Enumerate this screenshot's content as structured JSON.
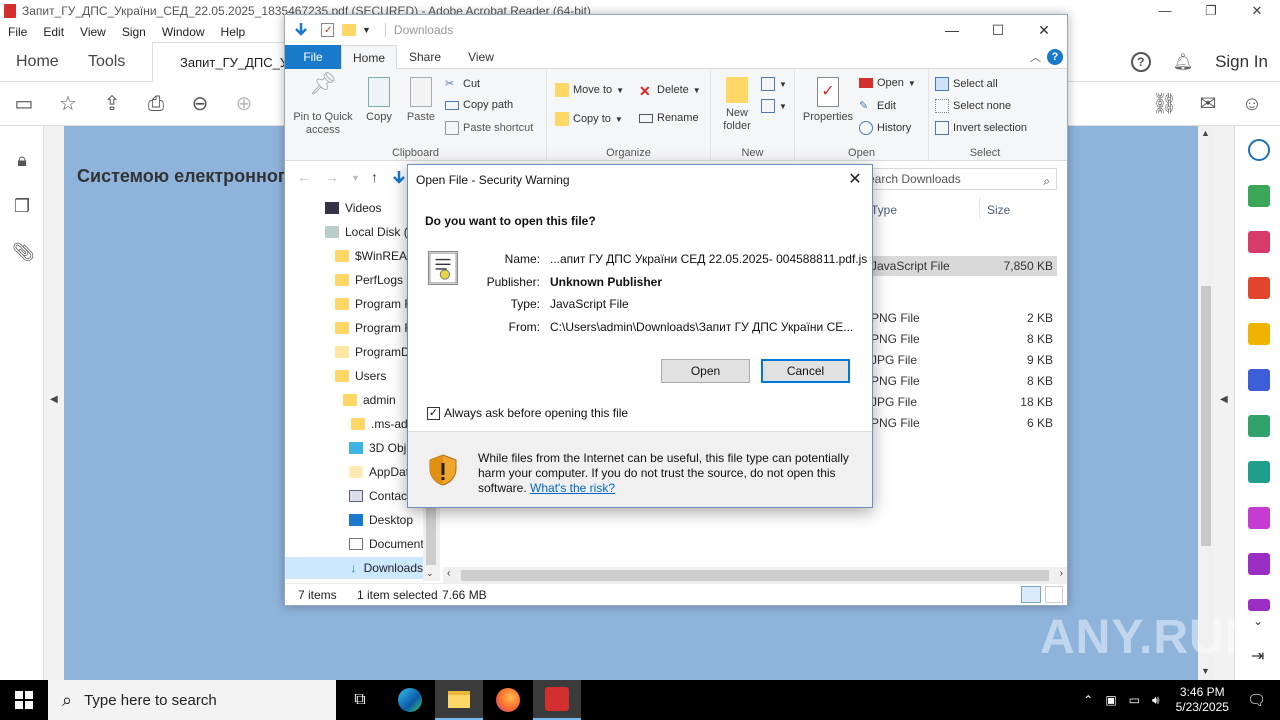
{
  "acrobat": {
    "title": "Запит_ГУ_ДПС_України_СЕД_22.05.2025_1835467235.pdf (SECURED) - Adobe Acrobat Reader (64-bit)",
    "menu": [
      "File",
      "Edit",
      "View",
      "Sign",
      "Window",
      "Help"
    ],
    "tabs": {
      "home": "Home",
      "tools": "Tools",
      "doc": "Запит_ГУ_ДПС_У"
    },
    "sign_in": "Sign In",
    "doc_heading": "Системою електронного"
  },
  "explorer": {
    "title": "Downloads",
    "ribbon_tabs": {
      "file": "File",
      "home": "Home",
      "share": "Share",
      "view": "View"
    },
    "clipboard": {
      "pin": "Pin to Quick access",
      "copy": "Copy",
      "paste": "Paste",
      "cut": "Cut",
      "copy_path": "Copy path",
      "paste_shortcut": "Paste shortcut",
      "label": "Clipboard"
    },
    "organize": {
      "move_to": "Move to",
      "copy_to": "Copy to",
      "delete": "Delete",
      "rename": "Rename",
      "label": "Organize"
    },
    "new": {
      "new_folder": "New folder",
      "label": "New"
    },
    "open": {
      "properties": "Properties",
      "open": "Open",
      "edit": "Edit",
      "history": "History",
      "label": "Open"
    },
    "select": {
      "select_all": "Select all",
      "select_none": "Select none",
      "invert": "Invert selection",
      "label": "Select"
    },
    "search_placeholder": "Search Downloads",
    "columns": {
      "type": "Type",
      "size": "Size"
    },
    "nav_items": [
      {
        "label": "Videos"
      },
      {
        "label": "Local Disk (C:)"
      },
      {
        "label": "$WinREAgent"
      },
      {
        "label": "PerfLogs"
      },
      {
        "label": "Program Files"
      },
      {
        "label": "Program Files (x86)"
      },
      {
        "label": "ProgramData"
      },
      {
        "label": "Users"
      },
      {
        "label": "admin"
      },
      {
        "label": ".ms-ad"
      },
      {
        "label": "3D Objects"
      },
      {
        "label": "AppData"
      },
      {
        "label": "Contacts"
      },
      {
        "label": "Desktop"
      },
      {
        "label": "Documents"
      },
      {
        "label": "Downloads"
      }
    ],
    "files": [
      {
        "type": "JavaScript File",
        "size": "7,850 KB",
        "selected": true
      },
      {
        "type": "PNG File",
        "size": "2 KB"
      },
      {
        "type": "PNG File",
        "size": "8 KB"
      },
      {
        "type": "JPG File",
        "size": "9 KB"
      },
      {
        "type": "PNG File",
        "size": "8 KB"
      },
      {
        "type": "JPG File",
        "size": "18 KB"
      },
      {
        "type": "PNG File",
        "size": "6 KB"
      }
    ],
    "status": {
      "count": "7 items",
      "selected": "1 item selected",
      "size": "7.66 MB"
    }
  },
  "dialog": {
    "title": "Open File - Security Warning",
    "question": "Do you want to open this file?",
    "name_label": "Name:",
    "name_value": "...апит ГУ ДПС України СЕД 22.05.2025- 004588811.pdf.js",
    "publisher_label": "Publisher:",
    "publisher_value": "Unknown Publisher",
    "type_label": "Type:",
    "type_value": "JavaScript File",
    "from_label": "From:",
    "from_value": "C:\\Users\\admin\\Downloads\\Запит ГУ ДПС України СЕ...",
    "open_button": "Open",
    "cancel_button": "Cancel",
    "checkbox_label": "Always ask before opening this file",
    "checkbox_checked": true,
    "warning_text": "While files from the Internet can be useful, this file type can potentially harm your computer. If you do not trust the source, do not open this software.",
    "risk_link": "What's the risk?"
  },
  "taskbar": {
    "search_placeholder": "Type here to search",
    "time": "3:46 PM",
    "date": "5/23/2025"
  },
  "watermark": "ANY.RUN",
  "colors": {
    "accent": "#1979ca",
    "doc_bg": "#8fb4dc",
    "acrobat_red": "#d32f2f"
  }
}
